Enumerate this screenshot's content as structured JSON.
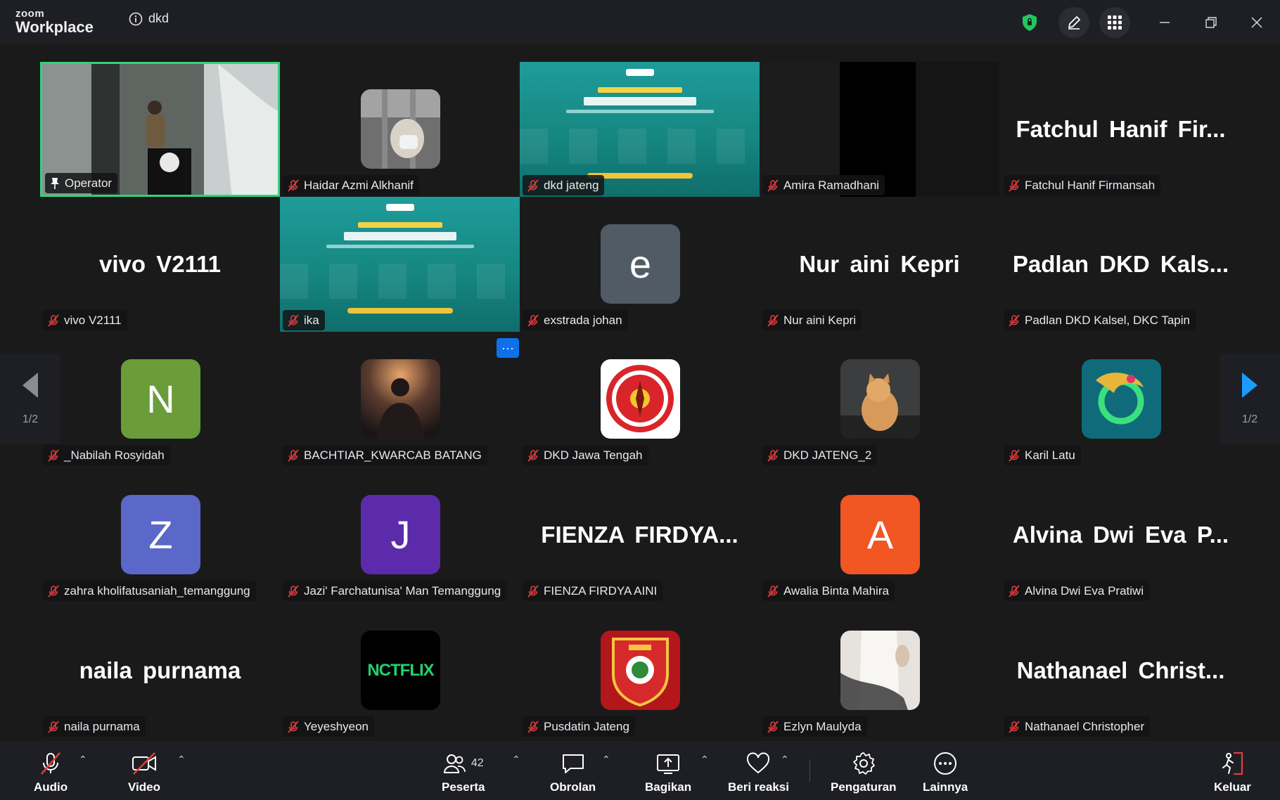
{
  "window": {
    "brand_small": "zoom",
    "brand_big": "Workplace",
    "meeting_name": "dkd"
  },
  "participants": [
    {
      "display": "video",
      "label": "Operator",
      "pin": true
    },
    {
      "display": "avatar",
      "label": "Haidar Azmi Alkhanif",
      "avatar": "photo-person"
    },
    {
      "display": "slide",
      "label": "dkd jateng"
    },
    {
      "display": "dark",
      "label": "Amira Ramadhani"
    },
    {
      "display": "name",
      "big": "Fatchul  Hanif  Fir...",
      "label": "Fatchul Hanif Firmansah"
    },
    {
      "display": "name",
      "big": "vivo V2111",
      "label": "vivo V2111"
    },
    {
      "display": "slide",
      "label": "ika"
    },
    {
      "display": "avatar",
      "label": "exstrada johan",
      "letter": "e",
      "color": "#515b66"
    },
    {
      "display": "name",
      "big": "Nur aini Kepri",
      "label": "Nur aini Kepri"
    },
    {
      "display": "name",
      "big": "Padlan  DKD  Kals...",
      "label": "Padlan DKD Kalsel, DKC Tapin"
    },
    {
      "display": "avatar",
      "label": "_Nabilah Rosyidah",
      "letter": "N",
      "color": "#6a9c3a"
    },
    {
      "display": "avatar",
      "label": "BACHTIAR_KWARCAB BATANG",
      "avatar": "photo-silhouette"
    },
    {
      "display": "avatar",
      "label": "DKD Jawa Tengah",
      "avatar": "logo-dkd"
    },
    {
      "display": "avatar",
      "label": "DKD JATENG_2",
      "avatar": "photo-cat"
    },
    {
      "display": "avatar",
      "label": "Karil Latu",
      "avatar": "art-dragon"
    },
    {
      "display": "avatar",
      "label": "zahra kholifatusaniah_temanggung",
      "letter": "Z",
      "color": "#5b68c9"
    },
    {
      "display": "avatar",
      "label": "Jazi' Farchatunisa' Man Temanggung",
      "letter": "J",
      "color": "#5b2bab"
    },
    {
      "display": "name",
      "big": "FIENZA  FIRDYA...",
      "label": "FIENZA FIRDYA AINI"
    },
    {
      "display": "avatar",
      "label": "Awalia Binta Mahira",
      "letter": "A",
      "color": "#f15623"
    },
    {
      "display": "name",
      "big": "Alvina Dwi Eva P...",
      "label": "Alvina Dwi Eva Pratiwi"
    },
    {
      "display": "name",
      "big": "naila purnama",
      "label": "naila purnama"
    },
    {
      "display": "avatar",
      "label": "Yeyeshyeon",
      "avatar": "logo-nctflix",
      "avatar_text": "NCTFLIX"
    },
    {
      "display": "avatar",
      "label": "Pusdatin Jateng",
      "avatar": "logo-jateng"
    },
    {
      "display": "avatar",
      "label": "Ezlyn Maulyda",
      "avatar": "photo-hand"
    },
    {
      "display": "name",
      "big": "Nathanael  Christ...",
      "label": "Nathanael Christopher"
    }
  ],
  "pagination": {
    "prev": "1/2",
    "next": "1/2"
  },
  "toolbar": {
    "audio": "Audio",
    "video": "Video",
    "participants": "Peserta",
    "participants_count": "42",
    "chat": "Obrolan",
    "share": "Bagikan",
    "react": "Beri reaksi",
    "settings": "Pengaturan",
    "more": "Lainnya",
    "leave": "Keluar"
  },
  "colors": {
    "accent": "#0e71eb",
    "active_border": "#31d37c",
    "muted": "#e23b3b",
    "shield": "#22c55e"
  }
}
